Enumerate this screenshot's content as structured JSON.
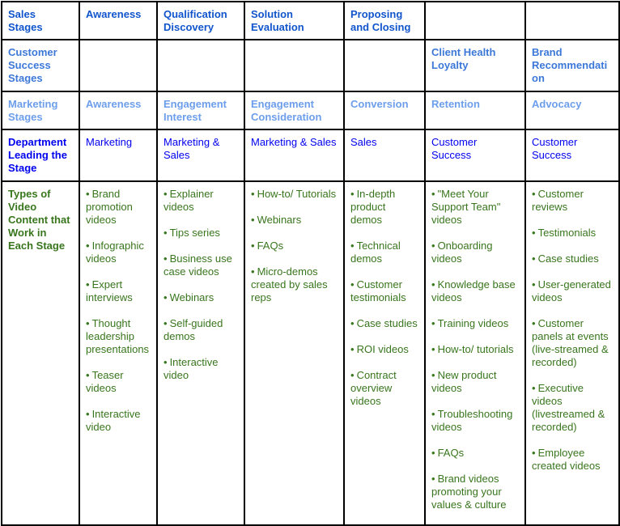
{
  "colors": {
    "sales_stage": "#1155cc",
    "customer_success_stage": "#3c78d8",
    "marketing_stage": "#6d9eeb",
    "department": "#0000ee",
    "video_types": "#38761d",
    "border": "#000000"
  },
  "bullet_icon": "•",
  "rows": {
    "sales": {
      "label": "Sales Stages",
      "cells": [
        "Awareness",
        "Qualification Discovery",
        "Solution Evaluation",
        "Proposing and Closing",
        "",
        ""
      ]
    },
    "customer_success": {
      "label": "Customer Success Stages",
      "cells": [
        "",
        "",
        "",
        "",
        "Client Health Loyalty",
        "Brand Recommendati on"
      ]
    },
    "marketing": {
      "label": "Marketing Stages",
      "cells": [
        "Awareness",
        "Engagement Interest",
        "Engagement Consideration",
        "Conversion",
        "Retention",
        "Advocacy"
      ]
    },
    "department": {
      "label": "Department Leading the Stage",
      "cells": [
        "Marketing",
        "Marketing & Sales",
        "Marketing & Sales",
        "Sales",
        "Customer Success",
        "Customer Success"
      ]
    },
    "video_types": {
      "label": "Types of Video Content that Work in Each Stage",
      "cells": [
        [
          "Brand promotion videos",
          "Infographic videos",
          "Expert interviews",
          "Thought leadership presentations",
          "Teaser videos",
          "Interactive video"
        ],
        [
          "Explainer videos",
          "Tips series",
          "Business use case videos",
          "Webinars",
          "Self-guided demos",
          "Interactive video"
        ],
        [
          "How-to/ Tutorials",
          "Webinars",
          "FAQs",
          "Micro-demos created by sales reps"
        ],
        [
          "In-depth product demos",
          "Technical demos",
          "Customer testimonials",
          "Case studies",
          "ROI videos",
          "Contract overview videos"
        ],
        [
          "\"Meet Your Support Team\" videos",
          "Onboarding videos",
          "Knowledge base videos",
          "Training videos",
          "How-to/ tutorials",
          "New product videos",
          "Troubleshooting videos",
          "FAQs",
          "Brand videos promoting your values & culture"
        ],
        [
          "Customer reviews",
          "Testimonials",
          "Case studies",
          "User-generated videos",
          "Customer panels at events (live-streamed & recorded)",
          "Executive videos (livestreamed & recorded)",
          "Employee created videos"
        ]
      ]
    }
  }
}
